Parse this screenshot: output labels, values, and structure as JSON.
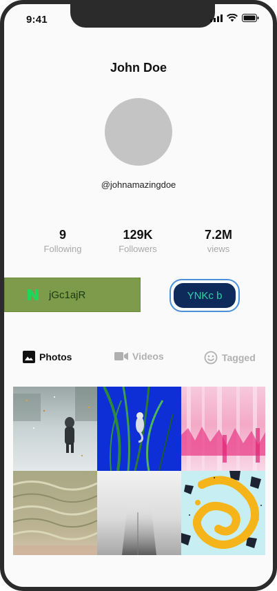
{
  "status_bar": {
    "time": "9:41"
  },
  "profile": {
    "name": "John Doe",
    "username": "@johnamazingdoe"
  },
  "stats": [
    {
      "value": "9",
      "label": "Following"
    },
    {
      "value": "129K",
      "label": "Followers"
    },
    {
      "value": "7.2M",
      "label": "views"
    }
  ],
  "buttons": {
    "primary_label": "jGc1ajR",
    "secondary_label": "YNKc b"
  },
  "tabs": [
    {
      "label": "Photos",
      "icon": "image-icon",
      "active": true
    },
    {
      "label": "Videos",
      "icon": "video-camera-icon",
      "active": false
    },
    {
      "label": "Tagged",
      "icon": "smiley-icon",
      "active": false
    }
  ],
  "photos": [
    {
      "subject": "person walking in snow"
    },
    {
      "subject": "seahorse among green plants"
    },
    {
      "subject": "pink abstract paint"
    },
    {
      "subject": "sand ripples"
    },
    {
      "subject": "skyscraper in fog"
    },
    {
      "subject": "yellow paint splash"
    }
  ],
  "colors": {
    "green_button": "#7d9b4a",
    "blue_button": "#0e2a5a",
    "blue_button_text": "#2fd1a8",
    "blue_outline": "#4a90d9"
  }
}
